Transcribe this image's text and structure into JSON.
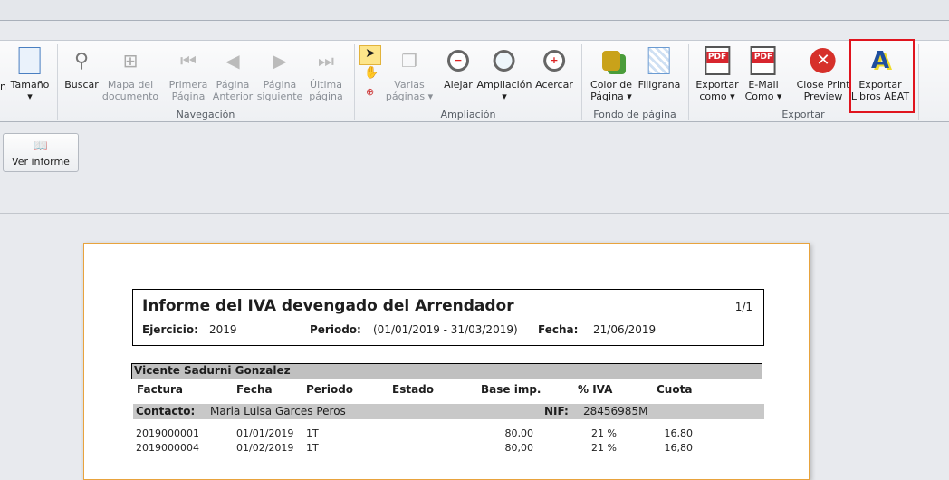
{
  "ribbon": {
    "buttons": [
      {
        "label1": "Tamaño",
        "label2": "▾",
        "icon": "page-size-icon",
        "enabled": true
      },
      {
        "label1": "Buscar",
        "label2": "",
        "icon": "binoculars-icon",
        "enabled": true
      },
      {
        "label1": "Mapa del",
        "label2": "documento",
        "icon": "document-map-icon",
        "enabled": false
      },
      {
        "label1": "Primera",
        "label2": "Página",
        "icon": "first-page-icon",
        "enabled": false
      },
      {
        "label1": "Página",
        "label2": "Anterior",
        "icon": "previous-page-icon",
        "enabled": false
      },
      {
        "label1": "Página",
        "label2": "siguiente",
        "icon": "next-page-icon",
        "enabled": false
      },
      {
        "label1": "Última",
        "label2": "página",
        "icon": "last-page-icon",
        "enabled": false
      },
      {
        "label1": "Varias",
        "label2": "páginas ▾",
        "icon": "multiple-pages-icon",
        "enabled": false
      },
      {
        "label1": "Alejar",
        "label2": "",
        "icon": "zoom-out-icon",
        "enabled": true
      },
      {
        "label1": "Ampliación",
        "label2": "▾",
        "icon": "zoom-icon",
        "enabled": true
      },
      {
        "label1": "Acercar",
        "label2": "",
        "icon": "zoom-in-icon",
        "enabled": true
      },
      {
        "label1": "Color de",
        "label2": "Página ▾",
        "icon": "page-color-icon",
        "enabled": true
      },
      {
        "label1": "Filigrana",
        "label2": "",
        "icon": "watermark-icon",
        "enabled": true
      },
      {
        "label1": "Exportar",
        "label2": "como ▾",
        "icon": "pdf-export-icon",
        "enabled": true
      },
      {
        "label1": "E-Mail",
        "label2": "Como ▾",
        "icon": "pdf-email-icon",
        "enabled": true
      },
      {
        "label1": "Close Print",
        "label2": "Preview",
        "icon": "close-icon",
        "enabled": true
      },
      {
        "label1": "Exportar",
        "label2": "Libros AEAT",
        "icon": "aeat-logo-icon",
        "enabled": true
      }
    ],
    "groups": [
      "Navegación",
      "Ampliación",
      "Fondo de página",
      "Exportar"
    ],
    "left_cut_label": "n"
  },
  "ver_informe": "Ver informe",
  "report": {
    "title": "Informe del IVA devengado del Arrendador",
    "page": "1/1",
    "ejercicio_label": "Ejercicio:",
    "ejercicio": "2019",
    "periodo_label": "Periodo:",
    "periodo": "(01/01/2019 - 31/03/2019)",
    "fecha_label": "Fecha:",
    "fecha": "21/06/2019",
    "arrendador": "Vicente Sadurni Gonzalez",
    "columns": [
      "Factura",
      "Fecha",
      "Periodo",
      "Estado",
      "Base imp.",
      "% IVA",
      "Cuota"
    ],
    "contacto_label": "Contacto:",
    "contacto": "Maria Luisa Garces Peros",
    "nif_label": "NIF:",
    "nif": "28456985M",
    "rows": [
      [
        "2019000001",
        "01/01/2019",
        "1T",
        "",
        "80,00",
        "21 %",
        "16,80"
      ],
      [
        "2019000004",
        "01/02/2019",
        "1T",
        "",
        "80,00",
        "21 %",
        "16,80"
      ]
    ]
  }
}
